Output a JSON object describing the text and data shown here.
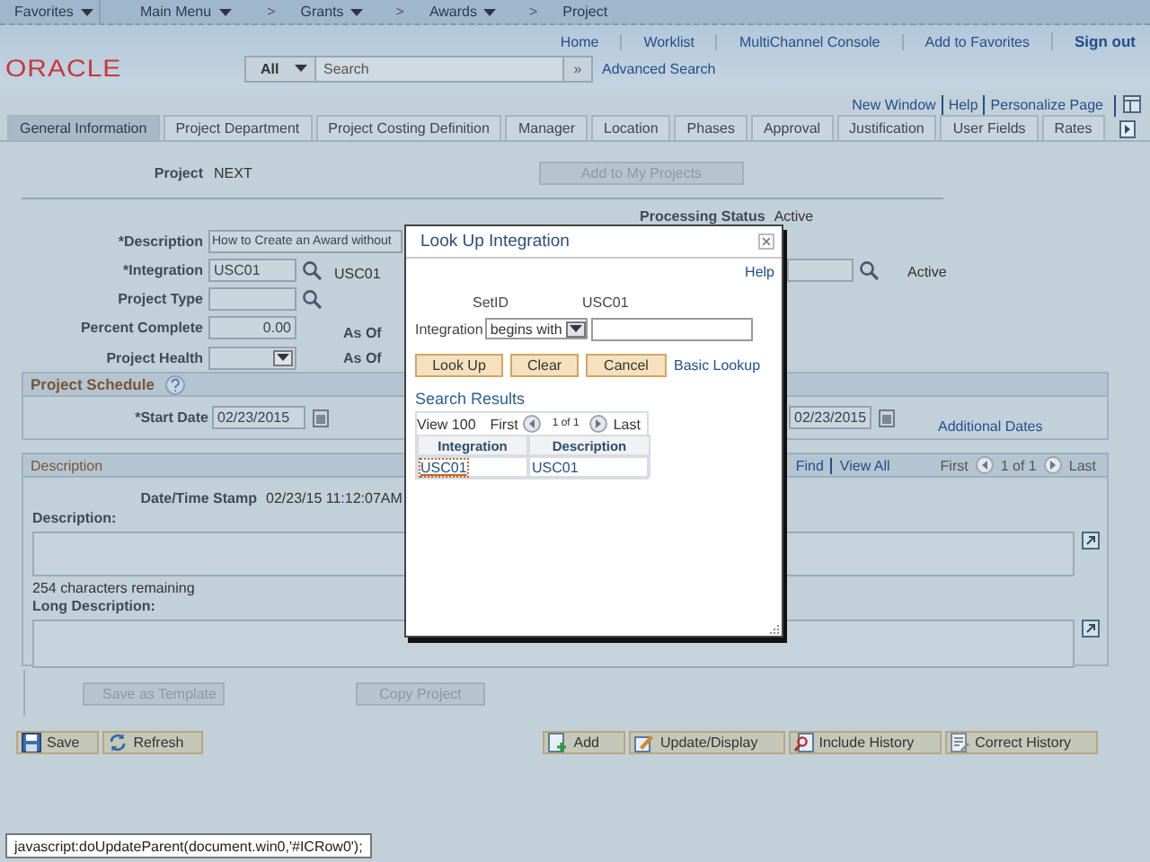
{
  "nav": [
    {
      "label": "Favorites",
      "dropdown": true,
      "crumb": false
    },
    {
      "label": "Main Menu",
      "dropdown": true,
      "crumb": false
    },
    {
      "label": "Grants",
      "dropdown": true,
      "crumb": true
    },
    {
      "label": "Awards",
      "dropdown": true,
      "crumb": true
    },
    {
      "label": "Project",
      "dropdown": false,
      "crumb": true
    }
  ],
  "breadcrumb_separator": ">",
  "header": {
    "logo": "ORACLE",
    "links": [
      "Home",
      "Worklist",
      "MultiChannel Console",
      "Add to Favorites"
    ],
    "sign_out": "Sign out"
  },
  "search": {
    "scope": "All",
    "placeholder": "Search",
    "go": "»",
    "advanced": "Advanced Search"
  },
  "page_links": [
    "New Window",
    "Help",
    "Personalize Page"
  ],
  "tabs": [
    {
      "label": "General Information",
      "selected": true
    },
    {
      "label": "Project Department",
      "selected": false
    },
    {
      "label": "Project Costing Definition",
      "selected": false
    },
    {
      "label": "Manager",
      "selected": false
    },
    {
      "label": "Location",
      "selected": false
    },
    {
      "label": "Phases",
      "selected": false
    },
    {
      "label": "Approval",
      "selected": false
    },
    {
      "label": "Justification",
      "selected": false
    },
    {
      "label": "User Fields",
      "selected": false
    },
    {
      "label": "Rates",
      "selected": false
    }
  ],
  "project": {
    "label": "Project",
    "value": "NEXT"
  },
  "add_to_projects": {
    "label": "Add to My Projects",
    "disabled": true
  },
  "processing_status": {
    "label": "Processing Status",
    "value": "Active"
  },
  "description_field": {
    "label": "*Description",
    "value": "How to Create an Award without"
  },
  "integration_field": {
    "label": "*Integration",
    "value": "USC01",
    "description": "USC01"
  },
  "right_status_field": {
    "status": "Active"
  },
  "project_type": {
    "label": "Project Type"
  },
  "percent_complete": {
    "label": "Percent Complete",
    "value": "0.00",
    "as_of": "As Of"
  },
  "project_health": {
    "label": "Project Health",
    "as_of": "As Of"
  },
  "project_schedule": {
    "title": "Project Schedule",
    "start_date_label": "*Start Date",
    "start_date": "02/23/2015",
    "end_date": "02/23/2015",
    "additional_dates": "Additional Dates"
  },
  "description_section": {
    "title": "Description",
    "find": "Find",
    "view_all": "View All",
    "first": "First",
    "count": "1 of 1",
    "last": "Last",
    "stamp_label": "Date/Time Stamp",
    "stamp": "02/23/15 11:12:07AM",
    "description_label": "Description:",
    "remaining": "254 characters remaining",
    "long_label": "Long Description:"
  },
  "template_buttons": [
    {
      "label": "Save as Template",
      "disabled": true
    },
    {
      "label": "Copy Project",
      "disabled": true
    }
  ],
  "toolbar_left": [
    {
      "label": "Save",
      "kind": "save"
    },
    {
      "label": "Refresh",
      "kind": "refresh"
    }
  ],
  "toolbar_right": [
    {
      "label": "Add",
      "kind": "add"
    },
    {
      "label": "Update/Display",
      "kind": "update"
    },
    {
      "label": "Include History",
      "kind": "history"
    },
    {
      "label": "Correct History",
      "kind": "correct"
    }
  ],
  "modal": {
    "title": "Look Up Integration",
    "help": "Help",
    "setid_label": "SetID",
    "setid": "USC01",
    "integration_label": "Integration",
    "operator": "begins with",
    "buttons": [
      "Look Up",
      "Clear",
      "Cancel"
    ],
    "basic_lookup": "Basic Lookup",
    "results_title": "Search Results",
    "view": "View 100",
    "first": "First",
    "count": "1 of 1",
    "last": "Last",
    "columns": [
      "Integration",
      "Description"
    ],
    "rows": [
      {
        "integration": "USC01",
        "description": "USC01",
        "focused": true
      }
    ]
  },
  "status_url": "javascript:doUpdateParent(document.win0,'#ICRow0');"
}
